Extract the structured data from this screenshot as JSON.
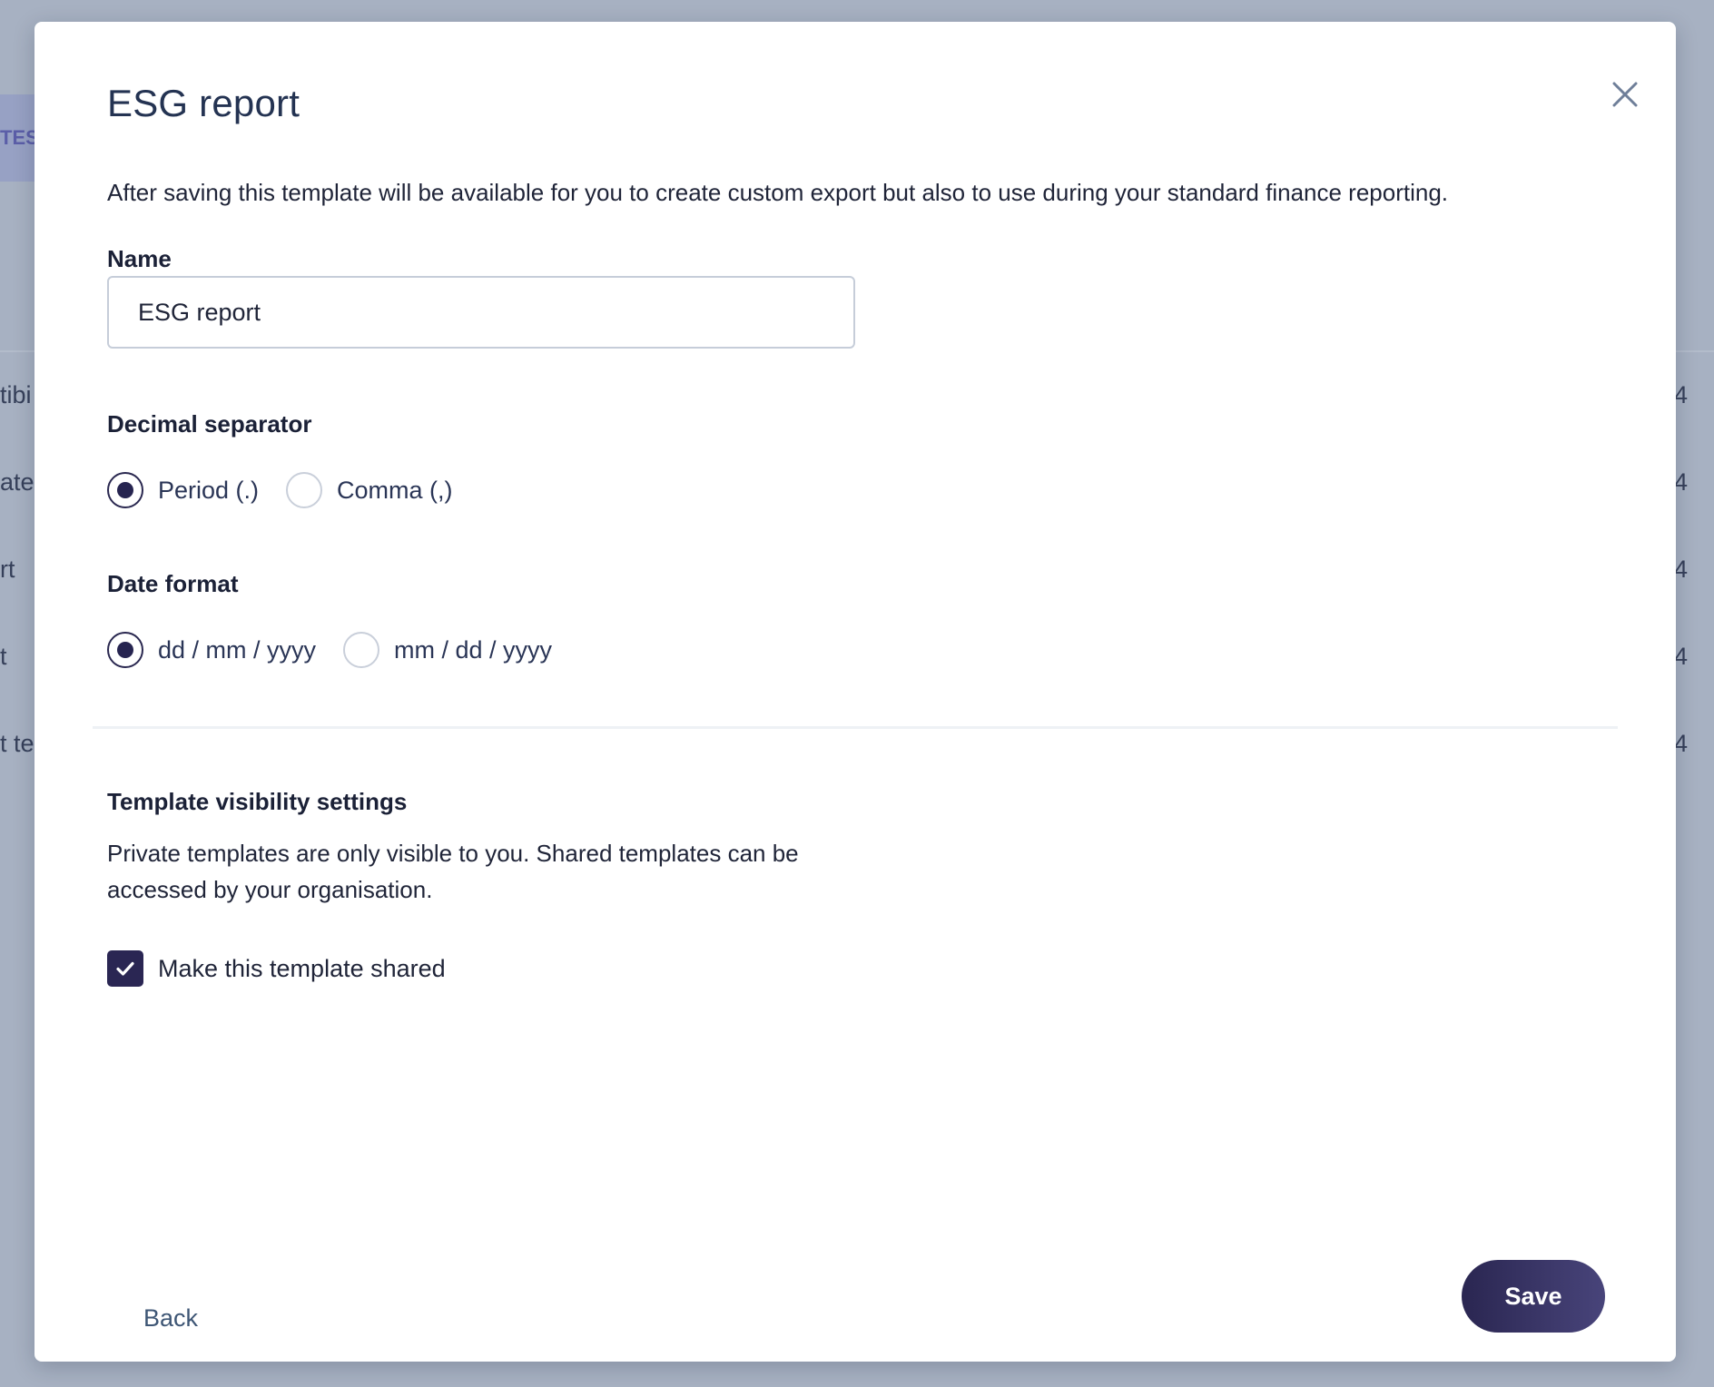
{
  "background": {
    "tab_fragment": "TES",
    "left_fragments": [
      "tibi",
      "ate",
      "rt",
      "t",
      "t te"
    ],
    "right_fragments": [
      "4",
      "4",
      "4",
      "4",
      "4"
    ]
  },
  "modal": {
    "title": "ESG report",
    "close_icon": "close-icon",
    "intro": "After saving this template will be available for you to create custom export but also to use during your standard finance reporting."
  },
  "name_field": {
    "label": "Name",
    "value": "ESG report",
    "placeholder": ""
  },
  "decimal_separator": {
    "label": "Decimal separator",
    "options": [
      {
        "label": "Period (.)",
        "selected": true
      },
      {
        "label": "Comma (,)",
        "selected": false
      }
    ]
  },
  "date_format": {
    "label": "Date format",
    "options": [
      {
        "label": "dd / mm / yyyy",
        "selected": true
      },
      {
        "label": "mm / dd / yyyy",
        "selected": false
      }
    ]
  },
  "visibility": {
    "heading": "Template visibility settings",
    "description": "Private templates are only visible to you. Shared templates can be accessed by your organisation.",
    "checkbox_label": "Make this template shared",
    "checked": true
  },
  "footer": {
    "back_label": "Back",
    "save_label": "Save"
  },
  "colors": {
    "accent": "#2a2653",
    "title": "#243352",
    "backdrop": "#a7b1c2"
  }
}
